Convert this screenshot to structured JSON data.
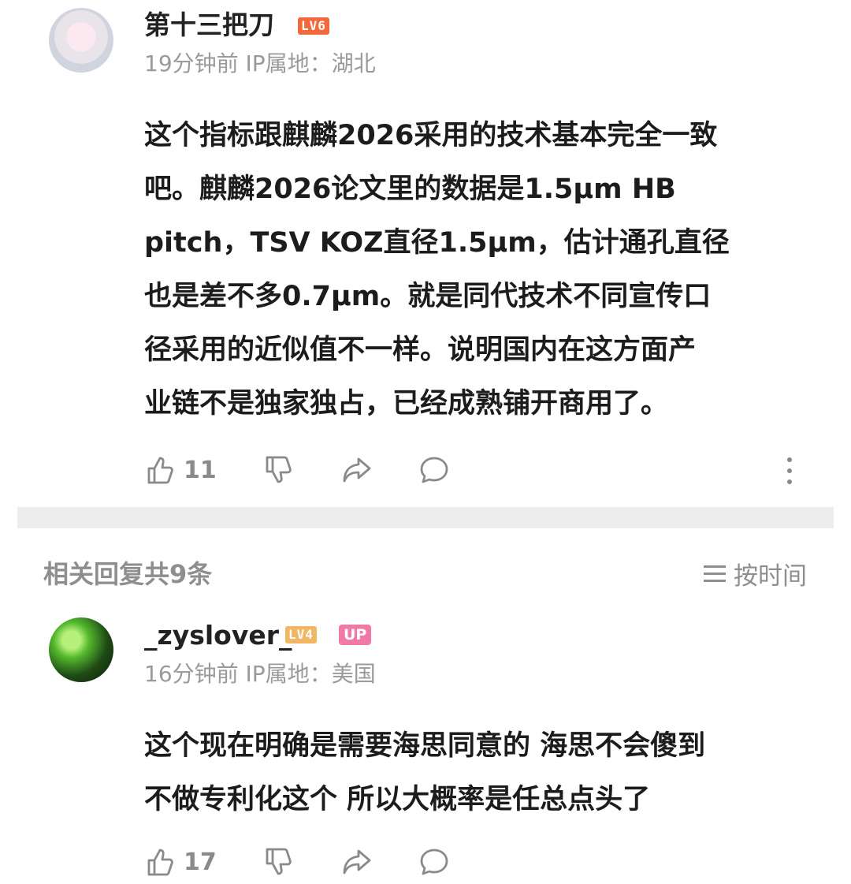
{
  "comment1": {
    "username": "第十三把刀",
    "level": "LV6",
    "time": "19分钟前",
    "ip": "IP属地：湖北",
    "lines": [
      "这个指标跟麒麟2026采用的技术基本完全一致",
      "吧。麒麟2026论文里的数据是1.5μm HB",
      "pitch，TSV KOZ直径1.5μm，估计通孔直径",
      "也是差不多0.7μm。就是同代技术不同宣传口",
      "径采用的近似值不一样。说明国内在这方面产",
      "业链不是独家独占，已经成熟铺开商用了。"
    ],
    "likes": "11"
  },
  "replies": {
    "header": "相关回复共9条",
    "sort_label": "按时间"
  },
  "comment2": {
    "username": "_zyslover_",
    "level": "LV4",
    "badge": "UP",
    "time": "16分钟前",
    "ip": "IP属地：美国",
    "lines": [
      "这个现在明确是需要海思同意的 海思不会傻到",
      "不做专利化这个 所以大概率是任总点头了"
    ],
    "likes": "17"
  },
  "colors": {
    "level6": "#f26a3b",
    "level4": "#f2b764",
    "up_badge": "#f07aa5",
    "meta_text": "#9a9a9a"
  },
  "icons": [
    "like-icon",
    "dislike-icon",
    "share-icon",
    "comment-icon",
    "more-icon",
    "sort-icon"
  ]
}
